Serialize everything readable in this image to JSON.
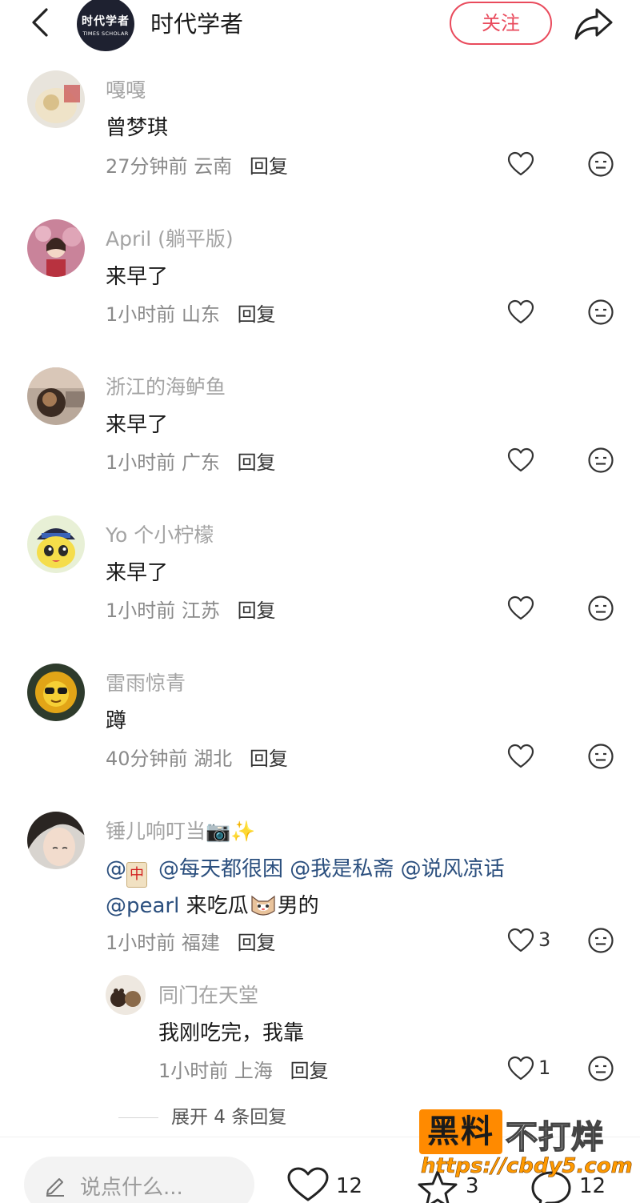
{
  "header": {
    "logo_line1": "时代学者",
    "logo_line2": "TIMES SCHOLAR",
    "account_name": "时代学者",
    "follow_label": "关注",
    "back_icon": "chevron-left-icon",
    "share_icon": "share-icon",
    "accent": "#e94a5c"
  },
  "comments": [
    {
      "user": "嘎嘎",
      "text": "曾梦琪",
      "time": "27分钟前",
      "location": "云南",
      "reply": "回复"
    },
    {
      "user": "April (躺平版)",
      "text": "来早了",
      "time": "1小时前",
      "location": "山东",
      "reply": "回复"
    },
    {
      "user": "浙江的海鲈鱼",
      "text": "来早了",
      "time": "1小时前",
      "location": "广东",
      "reply": "回复"
    },
    {
      "user": "Yo 个小柠檬",
      "text": "来早了",
      "time": "1小时前",
      "location": "江苏",
      "reply": "回复"
    },
    {
      "user": "雷雨惊青",
      "text": "蹲",
      "time": "40分钟前",
      "location": "湖北",
      "reply": "回复"
    },
    {
      "user": "锤儿响叮当",
      "user_emoji": "📷✨",
      "mention1_at": "@",
      "mention1_tile": "中",
      "mention2": "@每天都很困",
      "mention3": "@我是私斋",
      "mention4": "@说风凉话",
      "mention5": "@pearl",
      "text_a": "来吃瓜",
      "text_b": "男的",
      "time": "1小时前",
      "location": "福建",
      "reply": "回复",
      "likes": "3"
    }
  ],
  "sub_reply": {
    "user": "同门在天堂",
    "text": "我刚吃完，我靠",
    "time": "1小时前",
    "location": "上海",
    "reply": "回复",
    "likes": "1"
  },
  "expand_label": "展开 4 条回复",
  "bottom_bar": {
    "input_placeholder": "说点什么...",
    "like_count": "12",
    "star_count": "3",
    "comment_count": "12"
  },
  "watermark": {
    "box": "黑料",
    "text": "不打烊",
    "url": "https://cbdy5.com"
  }
}
